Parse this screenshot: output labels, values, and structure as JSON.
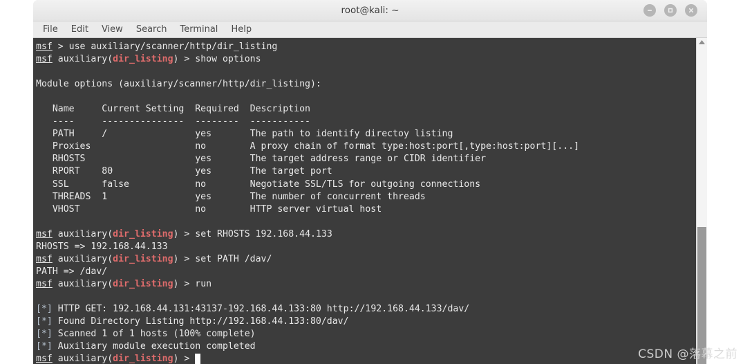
{
  "window": {
    "title": "root@kali: ~",
    "buttons": [
      {
        "name": "minimize",
        "glyph": "minimize-icon"
      },
      {
        "name": "maximize",
        "glyph": "maximize-icon"
      },
      {
        "name": "close",
        "glyph": "close-icon"
      }
    ]
  },
  "menubar": {
    "items": [
      {
        "label": "File"
      },
      {
        "label": "Edit"
      },
      {
        "label": "View"
      },
      {
        "label": "Search"
      },
      {
        "label": "Terminal"
      },
      {
        "label": "Help"
      }
    ]
  },
  "terminal": {
    "prompt_user": "msf",
    "module_name": "dir_listing",
    "cursor": "block",
    "lines": [
      {
        "id": "l00",
        "segs": [
          {
            "t": "msf",
            "c": "msf"
          },
          {
            "t": " > use auxiliary/scanner/http/dir_listing",
            "c": ""
          }
        ]
      },
      {
        "id": "l01",
        "segs": [
          {
            "t": "msf",
            "c": "msf"
          },
          {
            "t": " auxiliary(",
            "c": ""
          },
          {
            "t": "dir_listing",
            "c": "mod"
          },
          {
            "t": ") > show options",
            "c": ""
          }
        ]
      },
      {
        "id": "l02",
        "segs": [
          {
            "t": "",
            "c": ""
          }
        ]
      },
      {
        "id": "l03",
        "segs": [
          {
            "t": "Module options (auxiliary/scanner/http/dir_listing):",
            "c": ""
          }
        ]
      },
      {
        "id": "l04",
        "segs": [
          {
            "t": "",
            "c": ""
          }
        ]
      },
      {
        "id": "l05",
        "segs": [
          {
            "t": "   Name     Current Setting  Required  Description",
            "c": ""
          }
        ]
      },
      {
        "id": "l06",
        "segs": [
          {
            "t": "   ----     ---------------  --------  -----------",
            "c": ""
          }
        ]
      },
      {
        "id": "l07",
        "segs": [
          {
            "t": "   PATH     /                yes       The path to identify directoy listing",
            "c": ""
          }
        ]
      },
      {
        "id": "l08",
        "segs": [
          {
            "t": "   Proxies                   no        A proxy chain of format type:host:port[,type:host:port][...]",
            "c": ""
          }
        ]
      },
      {
        "id": "l09",
        "segs": [
          {
            "t": "   RHOSTS                    yes       The target address range or CIDR identifier",
            "c": ""
          }
        ]
      },
      {
        "id": "l10",
        "segs": [
          {
            "t": "   RPORT    80               yes       The target port",
            "c": ""
          }
        ]
      },
      {
        "id": "l11",
        "segs": [
          {
            "t": "   SSL      false            no        Negotiate SSL/TLS for outgoing connections",
            "c": ""
          }
        ]
      },
      {
        "id": "l12",
        "segs": [
          {
            "t": "   THREADS  1                yes       The number of concurrent threads",
            "c": ""
          }
        ]
      },
      {
        "id": "l13",
        "segs": [
          {
            "t": "   VHOST                     no        HTTP server virtual host",
            "c": ""
          }
        ]
      },
      {
        "id": "l14",
        "segs": [
          {
            "t": "",
            "c": ""
          }
        ]
      },
      {
        "id": "l15",
        "segs": [
          {
            "t": "msf",
            "c": "msf"
          },
          {
            "t": " auxiliary(",
            "c": ""
          },
          {
            "t": "dir_listing",
            "c": "mod"
          },
          {
            "t": ") > set RHOSTS 192.168.44.133",
            "c": ""
          }
        ]
      },
      {
        "id": "l16",
        "segs": [
          {
            "t": "RHOSTS => 192.168.44.133",
            "c": ""
          }
        ]
      },
      {
        "id": "l17",
        "segs": [
          {
            "t": "msf",
            "c": "msf"
          },
          {
            "t": " auxiliary(",
            "c": ""
          },
          {
            "t": "dir_listing",
            "c": "mod"
          },
          {
            "t": ") > set PATH /dav/",
            "c": ""
          }
        ]
      },
      {
        "id": "l18",
        "segs": [
          {
            "t": "PATH => /dav/",
            "c": ""
          }
        ]
      },
      {
        "id": "l19",
        "segs": [
          {
            "t": "msf",
            "c": "msf"
          },
          {
            "t": " auxiliary(",
            "c": ""
          },
          {
            "t": "dir_listing",
            "c": "mod"
          },
          {
            "t": ") > run",
            "c": ""
          }
        ]
      },
      {
        "id": "l20",
        "segs": [
          {
            "t": "",
            "c": ""
          }
        ]
      },
      {
        "id": "l21",
        "segs": [
          {
            "t": "[*]",
            "c": "star"
          },
          {
            "t": " HTTP GET: 192.168.44.131:43137-192.168.44.133:80 http://192.168.44.133/dav/",
            "c": ""
          }
        ]
      },
      {
        "id": "l22",
        "segs": [
          {
            "t": "[*]",
            "c": "star"
          },
          {
            "t": " Found Directory Listing http://192.168.44.133:80/dav/",
            "c": ""
          }
        ]
      },
      {
        "id": "l23",
        "segs": [
          {
            "t": "[*]",
            "c": "star"
          },
          {
            "t": " Scanned 1 of 1 hosts (100% complete)",
            "c": ""
          }
        ]
      },
      {
        "id": "l24",
        "segs": [
          {
            "t": "[*]",
            "c": "star"
          },
          {
            "t": " Auxiliary module execution completed",
            "c": ""
          }
        ]
      },
      {
        "id": "l25",
        "segs": [
          {
            "t": "msf",
            "c": "msf"
          },
          {
            "t": " auxiliary(",
            "c": ""
          },
          {
            "t": "dir_listing",
            "c": "mod"
          },
          {
            "t": ") > ",
            "c": ""
          },
          {
            "t": " ",
            "c": "cursor"
          }
        ]
      }
    ]
  },
  "scrollbar": {
    "up_arrow": "scroll-up-arrow-icon"
  },
  "watermark": {
    "text": "CSDN @落幕之前"
  },
  "colors": {
    "terminal_bg": "#3c3c3c",
    "terminal_fg": "#e8e8e8",
    "module_accent": "#e06c6c",
    "info_marker": "#b7c3cf",
    "chrome": "#ebebeb"
  }
}
